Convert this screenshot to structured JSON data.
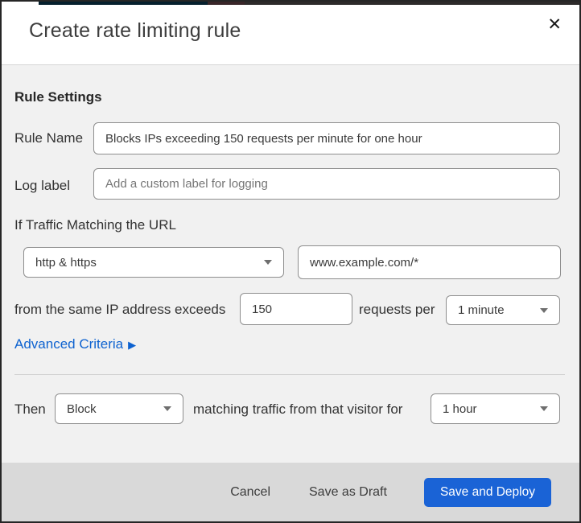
{
  "colors": {
    "primary_button": "#1a63d6",
    "link": "#0d62d0",
    "body_background": "#f1f1f1",
    "footer_background": "#d9d9d9"
  },
  "icons": {
    "close": "✕",
    "dropdown_caret": "chevron-down",
    "link_arrow": "▶"
  },
  "modal": {
    "title": "Create rate limiting rule"
  },
  "form": {
    "section_heading": "Rule Settings",
    "rule_name_label": "Rule Name",
    "rule_name_value": "Blocks IPs exceeding 150 requests per minute for one hour",
    "log_label_label": "Log label",
    "log_label_placeholder": "Add a custom label for logging",
    "traffic_matching_text": "If Traffic Matching the URL",
    "scheme_value": "http & https",
    "url_value": "www.example.com/*",
    "exceeds_text": "from the same IP address exceeds",
    "requests_value": "150",
    "requests_per_text": "requests per",
    "period_value": "1 minute",
    "advanced_criteria_label": "Advanced Criteria",
    "then_label": "Then",
    "action_value": "Block",
    "matching_text": "matching traffic from that visitor for",
    "duration_value": "1 hour"
  },
  "footer": {
    "cancel": "Cancel",
    "save_draft": "Save as Draft",
    "save_deploy": "Save and Deploy"
  }
}
